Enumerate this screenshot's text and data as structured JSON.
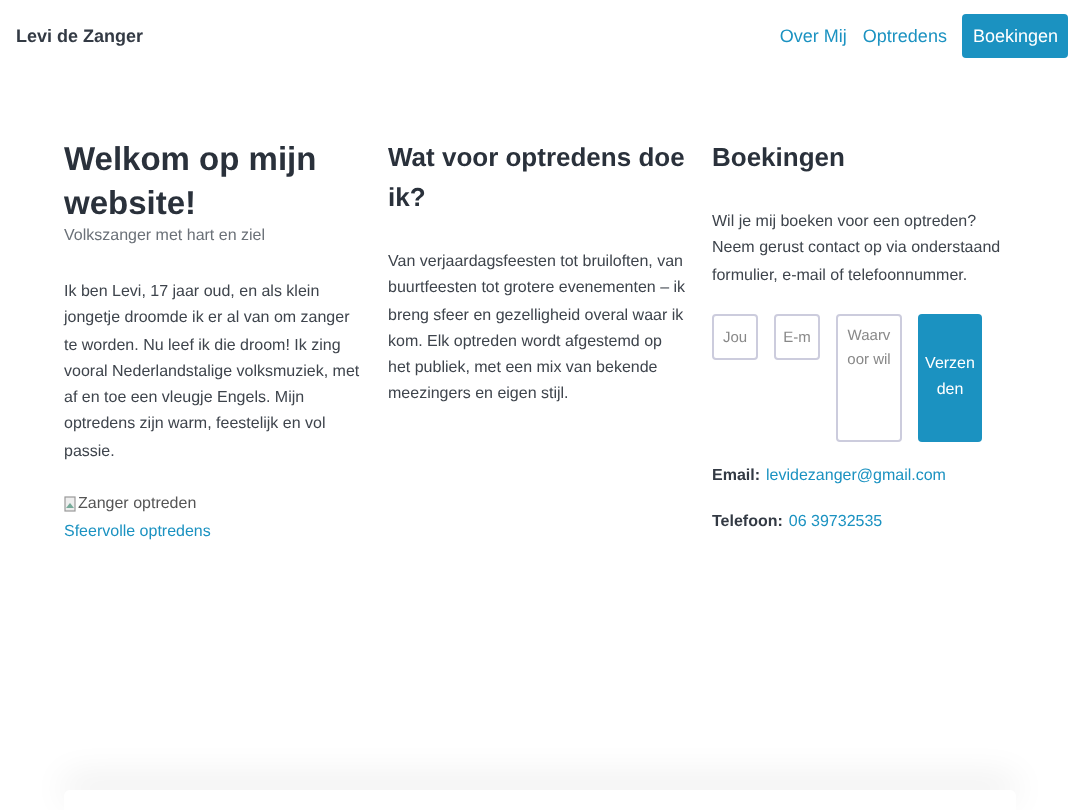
{
  "header": {
    "brand": "Levi de Zanger",
    "nav": [
      {
        "label": "Over Mij",
        "selected": false
      },
      {
        "label": "Optredens",
        "selected": false
      },
      {
        "label": "Boekingen",
        "selected": true
      }
    ]
  },
  "about": {
    "title": "Welkom op mijn website!",
    "subtitle": "Volkszanger met hart en ziel",
    "text": "Ik ben Levi, 17 jaar oud, en als klein jongetje droomde ik er al van om zanger te worden. Nu leef ik die droom! Ik zing vooral Nederlandstalige volksmuziek, met af en toe een vleugje Engels. Mijn optredens zijn warm, feestelijk en vol passie.",
    "image_alt": "Zanger optreden",
    "link": "Sfeervolle optredens"
  },
  "performances": {
    "title": "Wat voor optredens doe ik?",
    "text": "Van verjaardagsfeesten tot bruiloften, van buurtfeesten tot grotere evenementen – ik breng sfeer en gezelligheid overal waar ik kom. Elk optreden wordt afgestemd op het publiek, met een mix van bekende meezingers en eigen stijl."
  },
  "bookings": {
    "title": "Boekingen",
    "text": "Wil je mij boeken voor een optreden? Neem gerust contact op via onderstaand formulier, e-mail of telefoonnummer.",
    "form": {
      "fields": [
        {
          "kind": "input",
          "placeholder": "Jou"
        },
        {
          "kind": "input",
          "placeholder": "E-m"
        },
        {
          "kind": "textarea",
          "placeholder": "Waarvoor wil"
        }
      ],
      "submit": "Verzenden"
    },
    "contacts": [
      {
        "label": "Email:",
        "value": "levidezanger@gmail.com"
      },
      {
        "label": "Telefoon:",
        "value": "06 39732535"
      }
    ]
  }
}
